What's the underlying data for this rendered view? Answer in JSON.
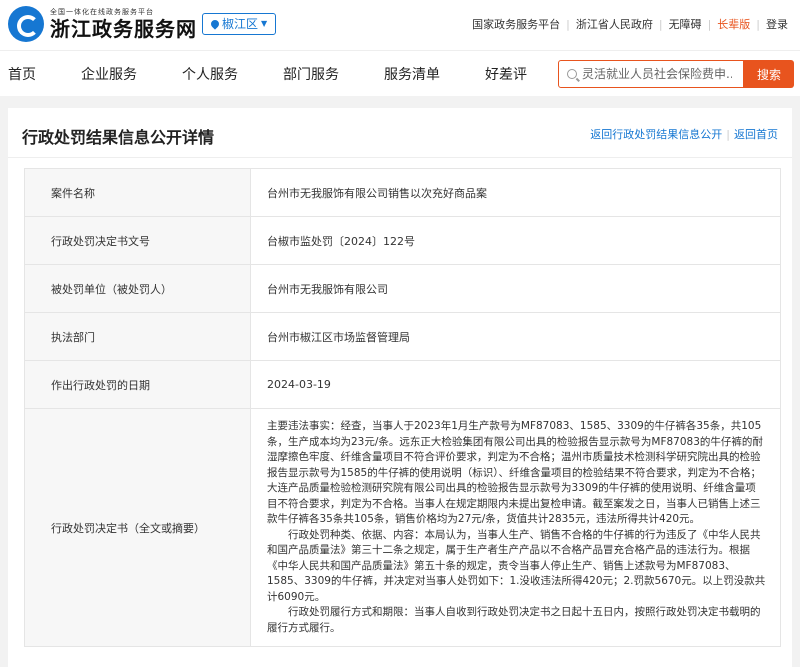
{
  "header": {
    "slogan": "全国一体化在线政务服务平台",
    "site_name": "浙江政务服务网",
    "region": "椒江区",
    "links": [
      "国家政务服务平台",
      "浙江省人民政府",
      "无障碍",
      "长辈版",
      "登录"
    ]
  },
  "nav": {
    "items": [
      "首页",
      "企业服务",
      "个人服务",
      "部门服务",
      "服务清单",
      "好差评"
    ],
    "search_placeholder": "灵活就业人员社会保险费申...",
    "search_button": "搜索"
  },
  "page": {
    "title": "行政处罚结果信息公开详情",
    "back_list": "返回行政处罚结果信息公开",
    "back_home": "返回首页"
  },
  "details": [
    {
      "label": "案件名称",
      "value": "台州市无我服饰有限公司销售以次充好商品案"
    },
    {
      "label": "行政处罚决定书文号",
      "value": "台椒市监处罚〔2024〕122号"
    },
    {
      "label": "被处罚单位（被处罚人）",
      "value": "台州市无我服饰有限公司"
    },
    {
      "label": "执法部门",
      "value": "台州市椒江区市场监督管理局"
    },
    {
      "label": "作出行政处罚的日期",
      "value": "2024-03-19"
    }
  ],
  "decision": {
    "label": "行政处罚决定书（全文或摘要）",
    "paragraphs": [
      "主要违法事实：经查，当事人于2023年1月生产款号为MF87083、1585、3309的牛仔裤各35条，共105条，生产成本均为23元/条。远东正大检验集团有限公司出具的检验报告显示款号为MF87083的牛仔裤的耐湿摩擦色牢度、纤维含量项目不符合评价要求，判定为不合格；温州市质量技术检测科学研究院出具的检验报告显示款号为1585的牛仔裤的使用说明（标识）、纤维含量项目的检验结果不符合要求，判定为不合格；大连产品质量检验检测研究院有限公司出具的检验报告显示款号为3309的牛仔裤的使用说明、纤维含量项目不符合要求，判定为不合格。当事人在规定期限内未提出复检申请。截至案发之日，当事人已销售上述三款牛仔裤各35条共105条，销售价格均为27元/条，货值共计2835元，违法所得共计420元。",
      "行政处罚种类、依据、内容：本局认为，当事人生产、销售不合格的牛仔裤的行为违反了《中华人民共和国产品质量法》第三十二条之规定，属于生产者生产产品以不合格产品冒充合格产品的违法行为。根据《中华人民共和国产品质量法》第五十条的规定，责令当事人停止生产、销售上述款号为MF87083、1585、3309的牛仔裤，并决定对当事人处罚如下：1.没收违法所得420元；2.罚款5670元。以上罚没款共计6090元。",
      "行政处罚履行方式和期限：当事人自收到行政处罚决定书之日起十五日内，按照行政处罚决定书载明的履行方式履行。"
    ]
  }
}
